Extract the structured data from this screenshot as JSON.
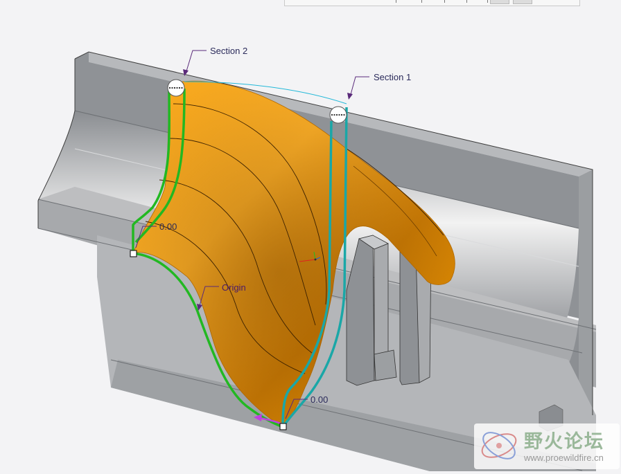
{
  "toolbar": {
    "buttons": [
      "view-button-1",
      "view-button-2"
    ]
  },
  "annotations": {
    "section_2": "Section 2",
    "section_1": "Section 1",
    "origin": "Origin",
    "dim_left": "0.00",
    "dim_bottom": "0.00"
  },
  "watermark": {
    "title": "野火论坛",
    "url": "www.proewildfire.cn"
  },
  "colors": {
    "background": "#f3f3f5",
    "sweep_surface": "#ef9a00",
    "section_2_curve": "#22b822",
    "section_1_curve": "#1aa7a7",
    "origin_trajectory": "#22b822",
    "part_gray": "#8f9296"
  }
}
